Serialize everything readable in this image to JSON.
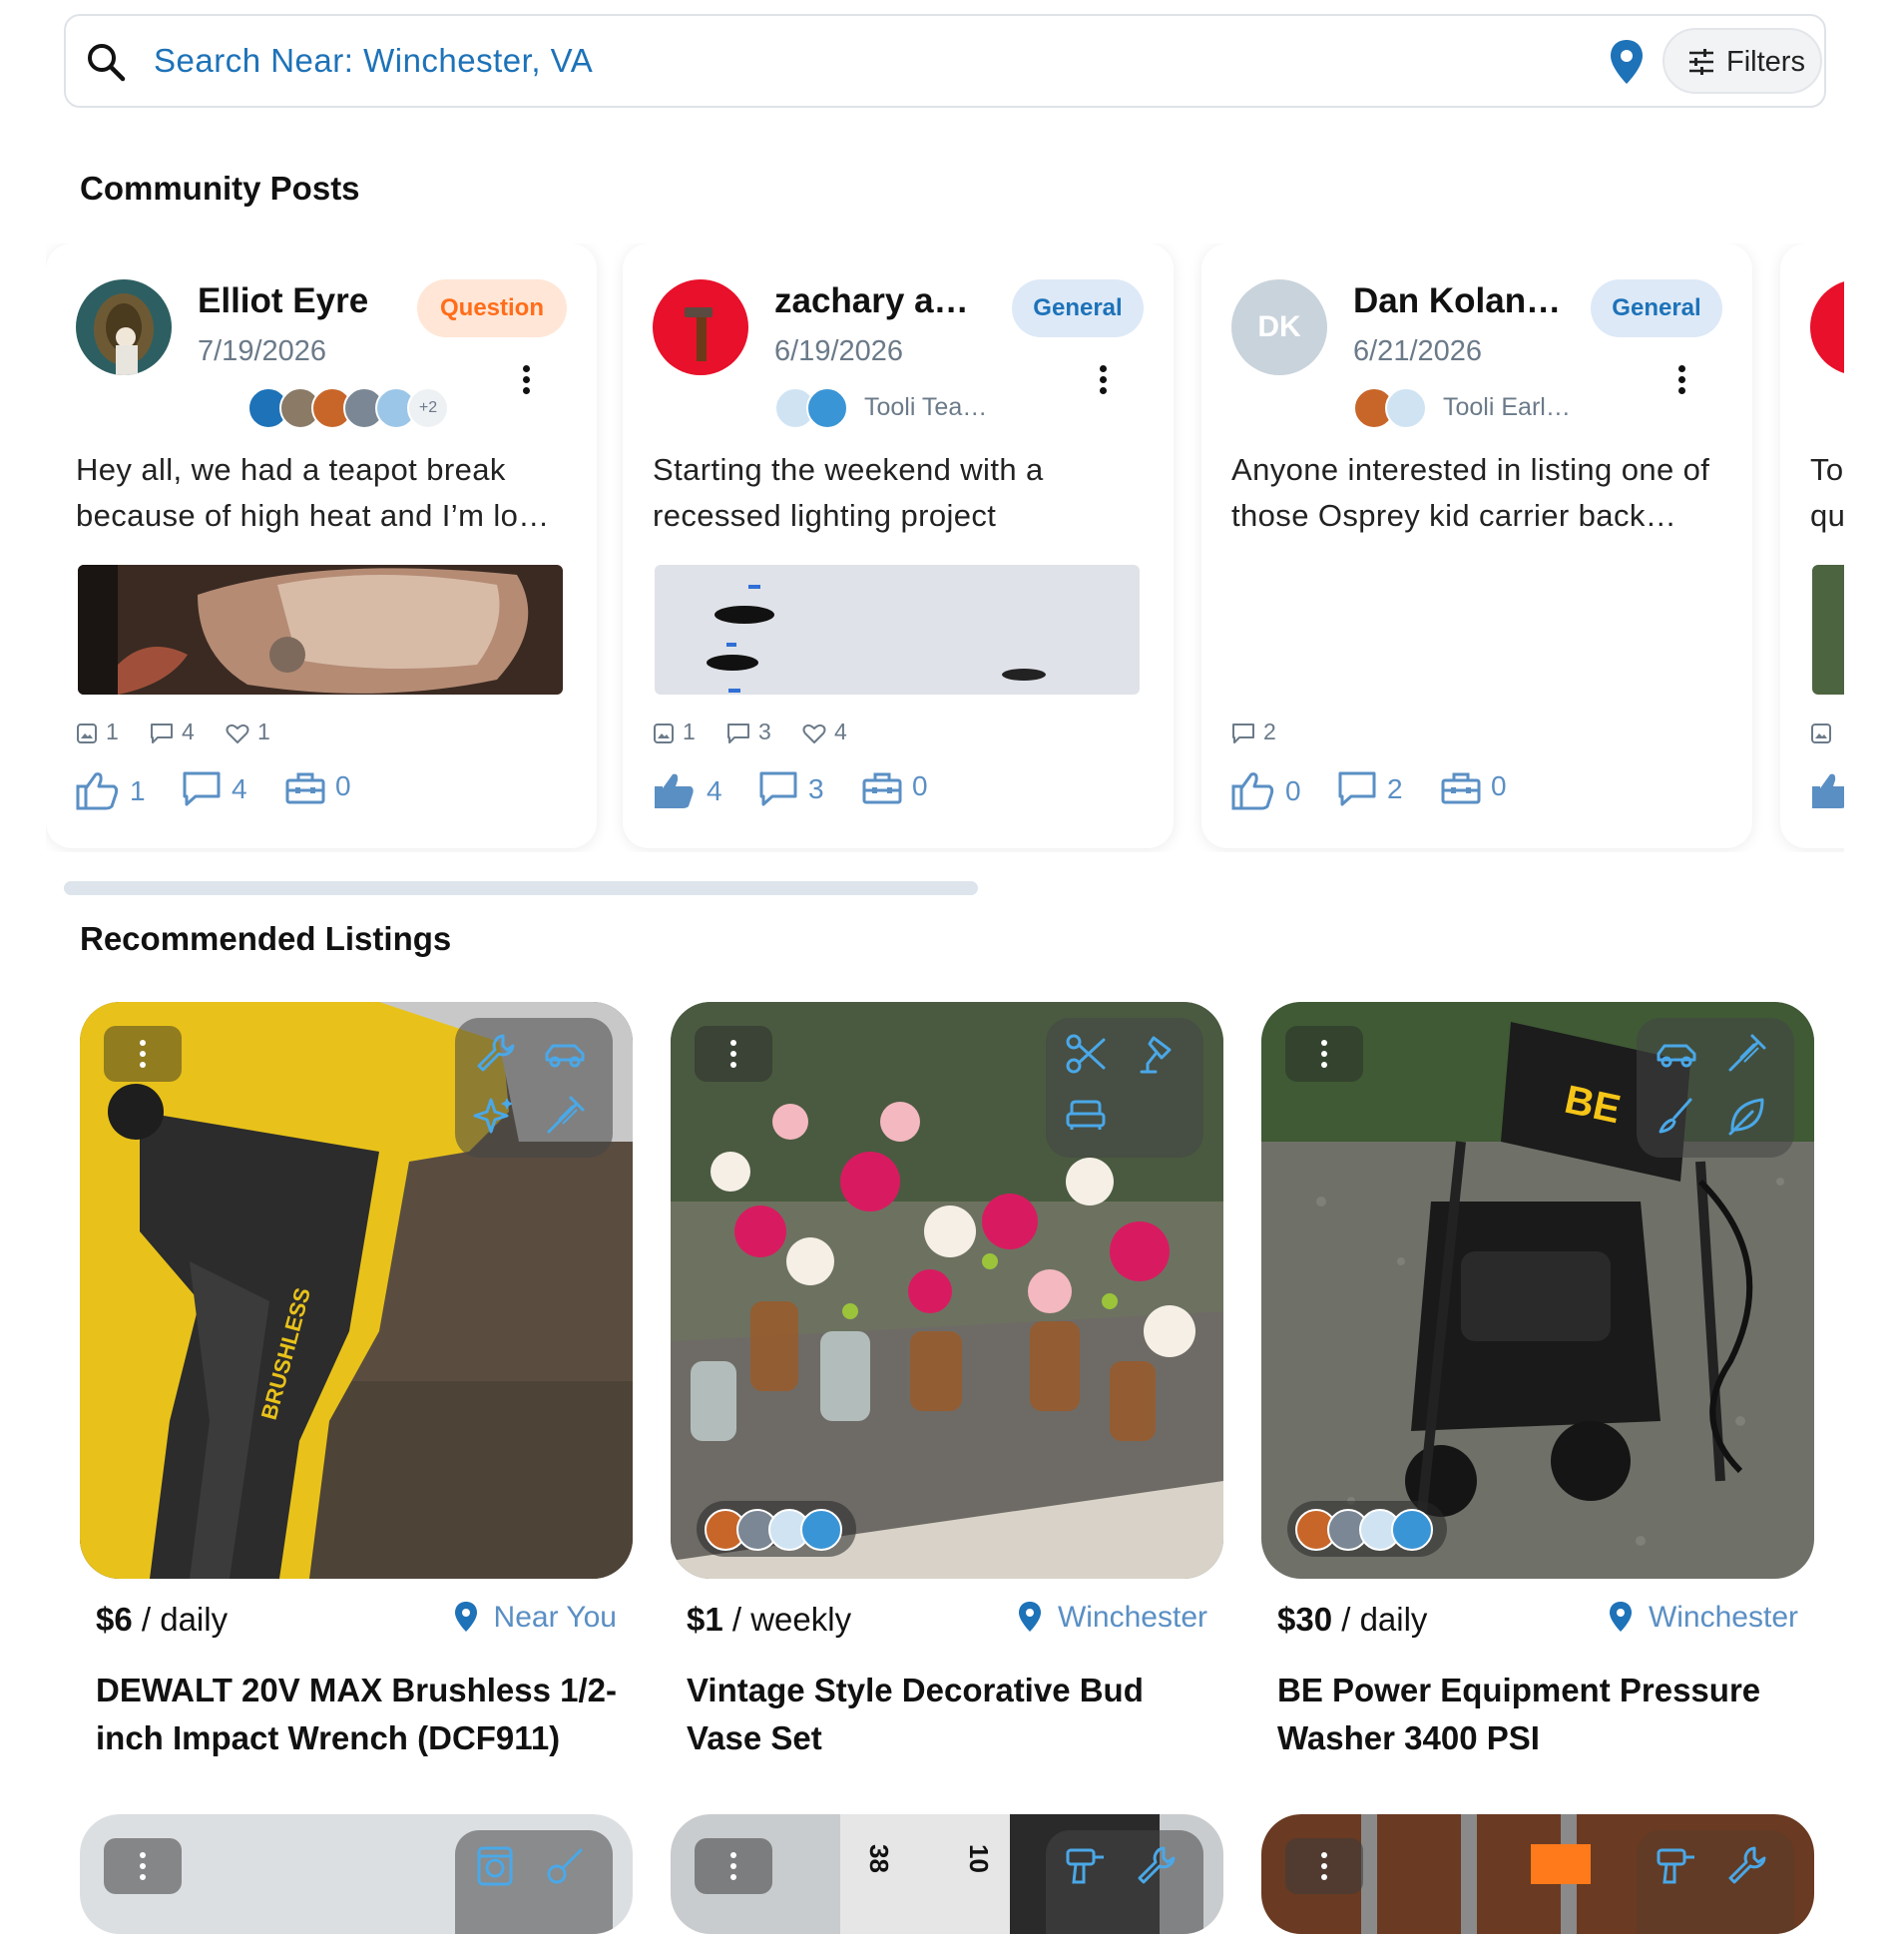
{
  "search": {
    "placeholder": "Search Near: Winchester, VA",
    "filters_label": "Filters"
  },
  "community": {
    "title": "Community Posts",
    "posts": [
      {
        "author": "Elliot Eyre",
        "date": "7/19/2026",
        "tag": "Question",
        "more_groups": "+2",
        "body": "Hey all, we had a teapot break because of high heat and I’m lo…",
        "stats": {
          "images": "1",
          "comments": "4",
          "likes": "1"
        },
        "actions": {
          "thumbs": "1",
          "comments": "4",
          "toolbox": "0"
        }
      },
      {
        "author": "zachary ant…",
        "date": "6/19/2026",
        "tag": "General",
        "group_name": "Tooli Tea…",
        "body": "Starting the weekend with a recessed lighting project",
        "stats": {
          "images": "1",
          "comments": "3",
          "likes": "4"
        },
        "actions": {
          "thumbs": "4",
          "comments": "3",
          "toolbox": "0"
        }
      },
      {
        "author": "Dan Kolansky",
        "initials": "DK",
        "date": "6/21/2026",
        "tag": "General",
        "group_name": "Tooli Earl…",
        "body": "Anyone interested in listing one of those Osprey kid carrier back…",
        "stats": {
          "comments": "2"
        },
        "actions": {
          "thumbs": "0",
          "comments": "2",
          "toolbox": "0"
        }
      },
      {
        "body_line1": "To",
        "body_line2": "qu"
      }
    ]
  },
  "recommended": {
    "title": "Recommended Listings",
    "listings": [
      {
        "price": "$6",
        "period": " / daily",
        "location": "Near You",
        "title": "DEWALT 20V MAX Brushless 1/2-inch Impact Wrench (DCF911)"
      },
      {
        "price": "$1",
        "period": " / weekly",
        "location": "Winchester",
        "title": "Vintage Style Decorative Bud Vase Set"
      },
      {
        "price": "$30",
        "period": " / daily",
        "location": "Winchester",
        "title": "BE Power Equipment Pressure Washer 3400 PSI"
      }
    ],
    "photo_labels": {
      "brand": "BE",
      "tape_38": "38",
      "tape_10": "10"
    }
  },
  "colors": {
    "accent": "#1d72b8",
    "question": "#ff6d1a",
    "general": "#1d72b8",
    "muted": "#6b7a89"
  }
}
